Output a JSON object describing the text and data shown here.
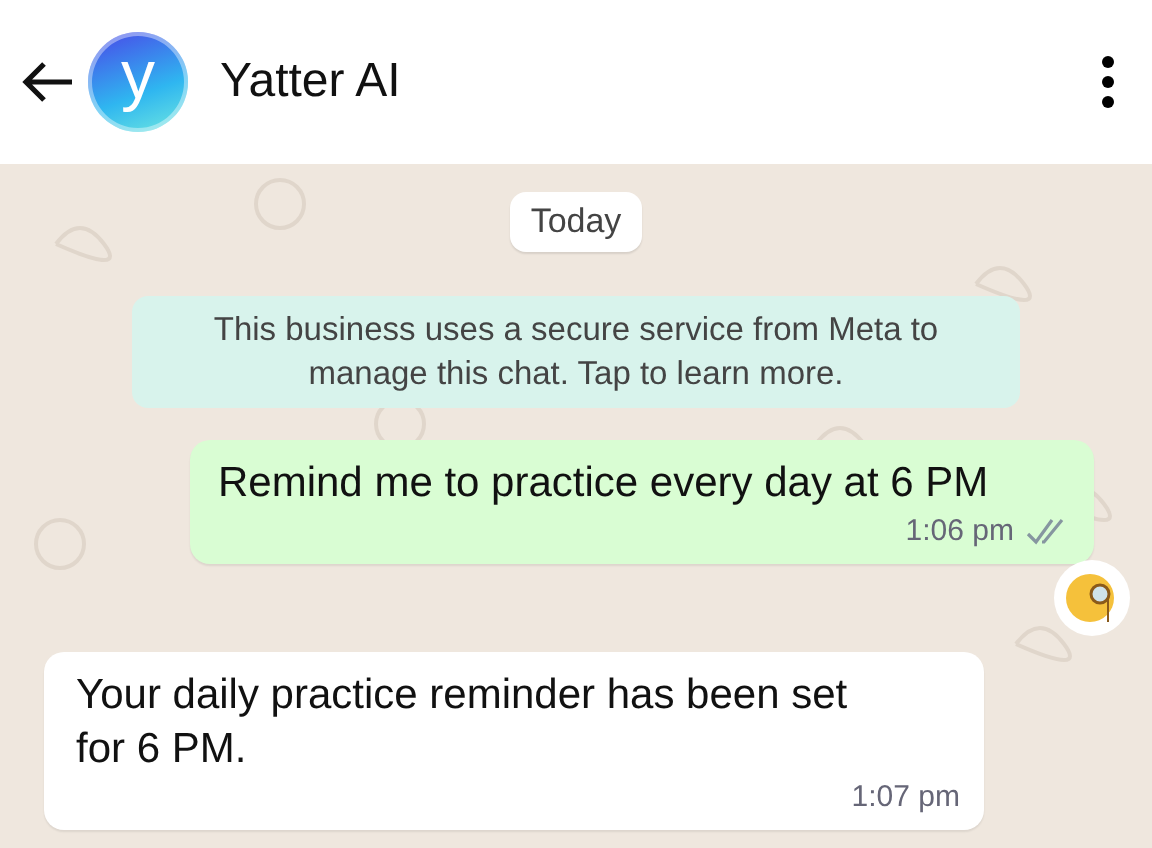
{
  "header": {
    "avatar_letter": "y",
    "title": "Yatter AI"
  },
  "date_divider": "Today",
  "notice": "This business uses a secure service from Meta to manage this chat. Tap to learn more.",
  "messages": [
    {
      "kind": "outgoing",
      "text": "Remind me to practice every day at 6 PM",
      "time": "1:06 pm",
      "delivered": true,
      "reaction": true
    },
    {
      "kind": "incoming",
      "text": "Your daily practice reminder has been set for 6 PM.",
      "time": "1:07 pm",
      "reaction": false
    }
  ]
}
